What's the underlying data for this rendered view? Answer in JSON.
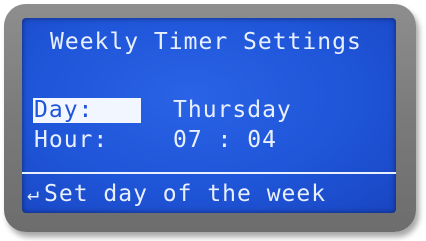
{
  "screen": {
    "title": "Weekly Timer Settings",
    "day_label": "Day:",
    "day_value": "Thursday",
    "hour_label": "Hour:",
    "hour_value": "07 : 04",
    "hint_icon": "↵",
    "hint_text": "Set day of the week"
  },
  "colors": {
    "lcd_background": "#1f55d8",
    "lcd_text": "#e8f0ff",
    "bezel": "#7a7a7a",
    "highlight": "#f2f6ff"
  }
}
